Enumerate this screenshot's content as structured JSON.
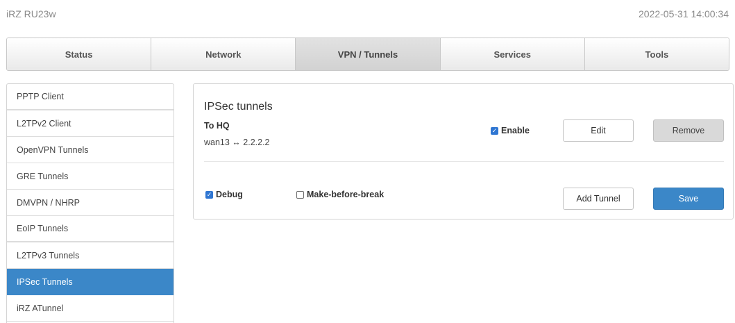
{
  "header": {
    "device_name": "iRZ RU23w",
    "datetime": "2022-05-31 14:00:34"
  },
  "tabs": [
    {
      "label": "Status",
      "active": false
    },
    {
      "label": "Network",
      "active": false
    },
    {
      "label": "VPN / Tunnels",
      "active": true
    },
    {
      "label": "Services",
      "active": false
    },
    {
      "label": "Tools",
      "active": false
    }
  ],
  "sidebar": {
    "items": [
      {
        "label": "PPTP Client"
      },
      {
        "label": "L2TPv2 Client"
      },
      {
        "label": "OpenVPN Tunnels"
      },
      {
        "label": "GRE Tunnels"
      },
      {
        "label": "DMVPN / NHRP"
      },
      {
        "label": "EoIP Tunnels"
      },
      {
        "label": "L2TPv3 Tunnels"
      },
      {
        "label": "IPSec Tunnels",
        "active": true
      },
      {
        "label": "iRZ ATunnel"
      }
    ]
  },
  "panel": {
    "title": "IPSec tunnels",
    "tunnel": {
      "name": "To HQ",
      "route": "wan13 ↔ 2.2.2.2",
      "enable_label": "Enable",
      "enable_checked": true,
      "edit_label": "Edit",
      "remove_label": "Remove"
    },
    "debug_label": "Debug",
    "debug_checked": true,
    "mbb_label": "Make-before-break",
    "mbb_checked": false,
    "add_tunnel_label": "Add Tunnel",
    "save_label": "Save"
  },
  "colors": {
    "accent": "#3b87c8",
    "checkbox": "#2f76d2"
  }
}
